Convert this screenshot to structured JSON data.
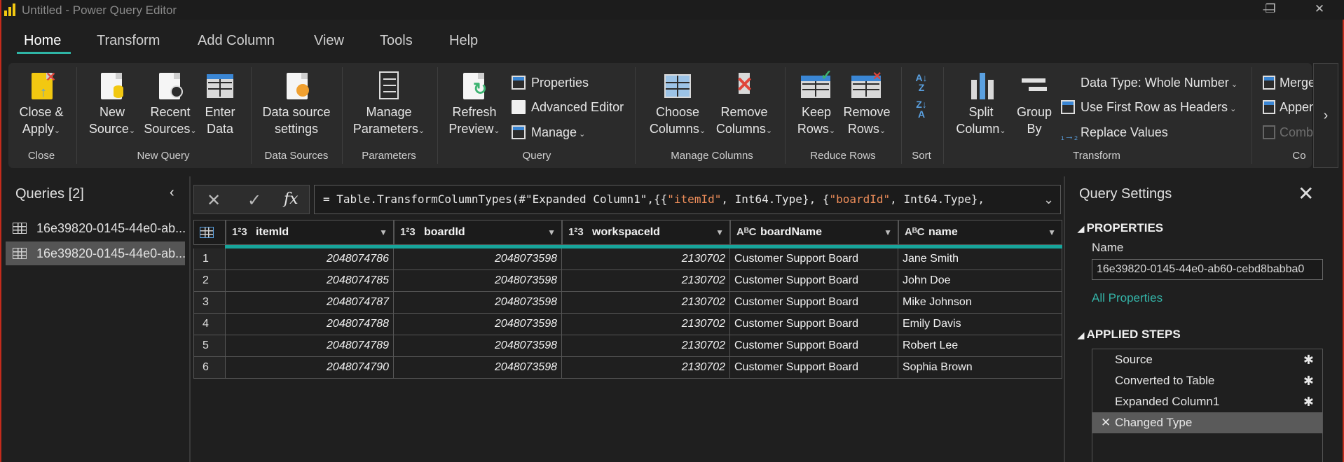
{
  "window": {
    "title": "Untitled - Power Query Editor",
    "minimize": "—",
    "restore": "❐",
    "close": "✕"
  },
  "tabs": [
    "Home",
    "Transform",
    "Add Column",
    "View",
    "Tools",
    "Help"
  ],
  "ribbon": {
    "close_apply": [
      "Close &",
      "Apply"
    ],
    "new_source": [
      "New",
      "Source"
    ],
    "recent_sources": [
      "Recent",
      "Sources"
    ],
    "enter_data": [
      "Enter",
      "Data"
    ],
    "data_source_settings": [
      "Data source",
      "settings"
    ],
    "manage_parameters": [
      "Manage",
      "Parameters"
    ],
    "refresh_preview": [
      "Refresh",
      "Preview"
    ],
    "properties": "Properties",
    "advanced_editor": "Advanced Editor",
    "manage": "Manage",
    "choose_columns": [
      "Choose",
      "Columns"
    ],
    "remove_columns": [
      "Remove",
      "Columns"
    ],
    "keep_rows": [
      "Keep",
      "Rows"
    ],
    "remove_rows": [
      "Remove",
      "Rows"
    ],
    "split_column": [
      "Split",
      "Column"
    ],
    "group_by": [
      "Group",
      "By"
    ],
    "data_type": "Data Type: Whole Number",
    "use_first_row": "Use First Row as Headers",
    "replace_values": "Replace Values",
    "merge": "Merge",
    "append": "Append",
    "combine": "Comb",
    "groups": {
      "close": "Close",
      "new_query": "New Query",
      "data_sources": "Data Sources",
      "parameters": "Parameters",
      "query": "Query",
      "manage_columns": "Manage Columns",
      "reduce_rows": "Reduce Rows",
      "sort": "Sort",
      "transform": "Transform",
      "combine": "Co"
    },
    "more": "›"
  },
  "queries": {
    "title": "Queries [2]",
    "collapse": "‹",
    "items": [
      "16e39820-0145-44e0-ab...",
      "16e39820-0145-44e0-ab..."
    ]
  },
  "formula_bar": {
    "cancel": "✕",
    "commit": "✓",
    "fx": "fx",
    "prefix": "= Table.TransformColumnTypes(#\"Expanded Column1\",{{",
    "s1": "\"itemId\"",
    "mid1": ", Int64.Type}, {",
    "s2": "\"boardId\"",
    "mid2": ", Int64.Type},",
    "expand": "⌄"
  },
  "table": {
    "columns": [
      {
        "type": "1²3",
        "name": "itemId"
      },
      {
        "type": "1²3",
        "name": "boardId"
      },
      {
        "type": "1²3",
        "name": "workspaceId"
      },
      {
        "type": "AᴮC",
        "name": "boardName"
      },
      {
        "type": "AᴮC",
        "name": "name"
      }
    ],
    "rows": [
      [
        "1",
        "2048074786",
        "2048073598",
        "2130702",
        "Customer Support Board",
        "Jane Smith"
      ],
      [
        "2",
        "2048074785",
        "2048073598",
        "2130702",
        "Customer Support Board",
        "John Doe"
      ],
      [
        "3",
        "2048074787",
        "2048073598",
        "2130702",
        "Customer Support Board",
        "Mike Johnson"
      ],
      [
        "4",
        "2048074788",
        "2048073598",
        "2130702",
        "Customer Support Board",
        "Emily Davis"
      ],
      [
        "5",
        "2048074789",
        "2048073598",
        "2130702",
        "Customer Support Board",
        "Robert Lee"
      ],
      [
        "6",
        "2048074790",
        "2048073598",
        "2130702",
        "Customer Support Board",
        "Sophia Brown"
      ]
    ]
  },
  "query_settings": {
    "title": "Query Settings",
    "close": "✕",
    "properties_header": "PROPERTIES",
    "name_label": "Name",
    "name_value": "16e39820-0145-44e0-ab60-cebd8babba0",
    "all_properties": "All Properties",
    "applied_steps_header": "APPLIED STEPS",
    "steps": [
      "Source",
      "Converted to Table",
      "Expanded Column1",
      "Changed Type"
    ]
  },
  "colors": {
    "accent": "#2fb5a6",
    "brand": "#f2c811",
    "window_border": "#c42b1c"
  }
}
